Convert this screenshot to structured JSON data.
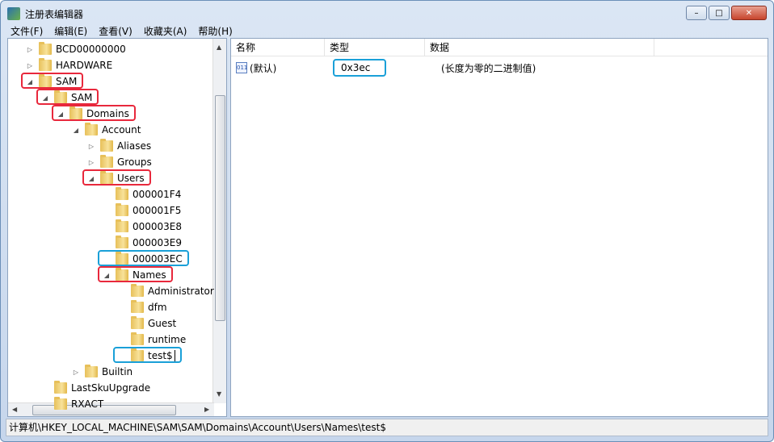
{
  "window": {
    "title": "注册表编辑器",
    "minimize": "–",
    "maximize": "□",
    "close": "✕"
  },
  "menu": [
    "文件(F)",
    "编辑(E)",
    "查看(V)",
    "收藏夹(A)",
    "帮助(H)"
  ],
  "tree": [
    {
      "label": "BCD00000000",
      "level": 0,
      "expander": "collapsed"
    },
    {
      "label": "HARDWARE",
      "level": 0,
      "expander": "collapsed"
    },
    {
      "label": "SAM",
      "level": 0,
      "expander": "expanded",
      "highlight": "#e8283c"
    },
    {
      "label": "SAM",
      "level": 1,
      "expander": "expanded",
      "highlight": "#e8283c"
    },
    {
      "label": "Domains",
      "level": 2,
      "expander": "expanded",
      "highlight": "#e8283c"
    },
    {
      "label": "Account",
      "level": 3,
      "expander": "expanded"
    },
    {
      "label": "Aliases",
      "level": 4,
      "expander": "collapsed"
    },
    {
      "label": "Groups",
      "level": 4,
      "expander": "collapsed"
    },
    {
      "label": "Users",
      "level": 4,
      "expander": "expanded",
      "highlight": "#e8283c"
    },
    {
      "label": "000001F4",
      "level": 5,
      "expander": "none"
    },
    {
      "label": "000001F5",
      "level": 5,
      "expander": "none"
    },
    {
      "label": "000003E8",
      "level": 5,
      "expander": "none"
    },
    {
      "label": "000003E9",
      "level": 5,
      "expander": "none"
    },
    {
      "label": "000003EC",
      "level": 5,
      "expander": "none",
      "highlight": "#1aa0d8"
    },
    {
      "label": "Names",
      "level": 5,
      "expander": "expanded",
      "highlight": "#e8283c"
    },
    {
      "label": "Administrator",
      "level": 6,
      "expander": "none"
    },
    {
      "label": "dfm",
      "level": 6,
      "expander": "none"
    },
    {
      "label": "Guest",
      "level": 6,
      "expander": "none"
    },
    {
      "label": "runtime",
      "level": 6,
      "expander": "none"
    },
    {
      "label": "test$",
      "level": 6,
      "expander": "none",
      "highlight": "#1aa0d8",
      "selected": true
    },
    {
      "label": "Builtin",
      "level": 3,
      "expander": "collapsed"
    },
    {
      "label": "LastSkuUpgrade",
      "level": 1,
      "expander": "none"
    },
    {
      "label": "RXACT",
      "level": 1,
      "expander": "none"
    }
  ],
  "list": {
    "columns": [
      "名称",
      "类型",
      "数据"
    ],
    "rows": [
      {
        "name": "(默认)",
        "type": "0x3ec",
        "data": "(长度为零的二进制值)",
        "icon": "binary-value-icon",
        "type_highlight": "#1aa0d8"
      }
    ]
  },
  "status_path": "计算机\\HKEY_LOCAL_MACHINE\\SAM\\SAM\\Domains\\Account\\Users\\Names\\test$"
}
